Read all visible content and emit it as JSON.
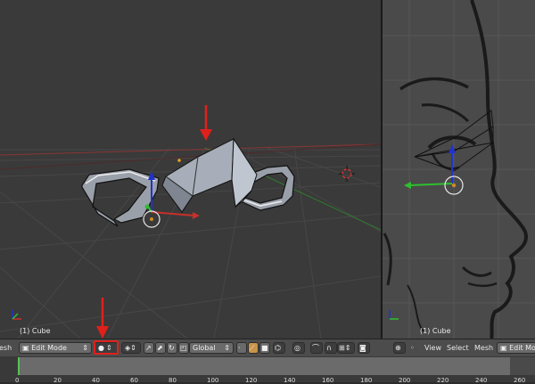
{
  "viewport_left": {
    "object_label": "(1) Cube"
  },
  "viewport_right": {
    "object_label": "(1) Cube"
  },
  "header": {
    "editor_menu_partial": "esh",
    "mode_label": "Edit Mode",
    "orientation_label": "Global",
    "menus": [
      "View",
      "Select",
      "Mesh"
    ],
    "mode_label_right": "Edit Mo"
  },
  "timeline": {
    "ticks": [
      "0",
      "20",
      "40",
      "60",
      "80",
      "100",
      "120",
      "140",
      "160",
      "180",
      "200",
      "220",
      "240",
      "260"
    ]
  },
  "colors": {
    "annotation_red": "#e0201b",
    "axis_x": "#c8302a",
    "axis_y": "#2fbf2f",
    "axis_z": "#2233cc",
    "current_frame": "#56c456"
  }
}
